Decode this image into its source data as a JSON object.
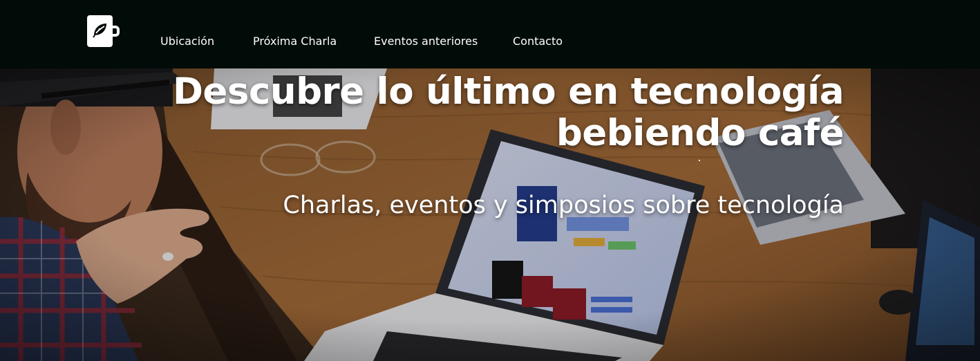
{
  "nav": {
    "logo_icon": "coffee-mug-leaf-icon",
    "links": [
      {
        "label": "Ubicación"
      },
      {
        "label": "Próxima Charla"
      },
      {
        "label": "Eventos anteriores"
      },
      {
        "label": "Contacto"
      }
    ]
  },
  "hero": {
    "title_line1": "Descubre lo último en tecnología",
    "title_line2": "bebiendo café",
    "subtitle": "Charlas, eventos y simposios sobre tecnología"
  },
  "colors": {
    "nav_background": "#010b08",
    "text": "#ffffff"
  }
}
